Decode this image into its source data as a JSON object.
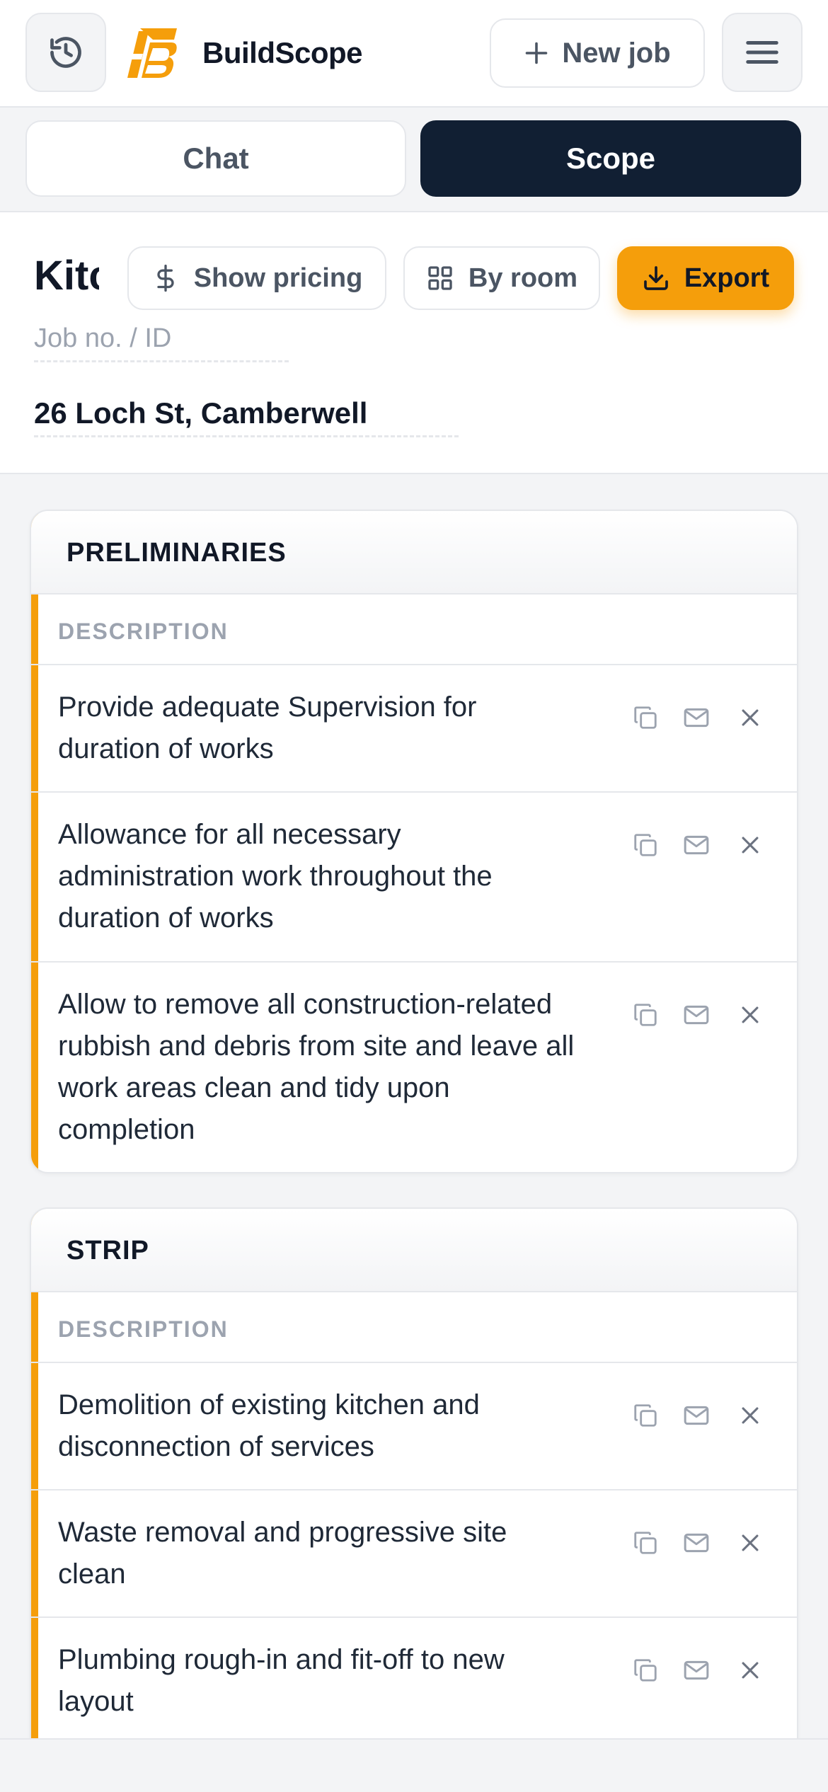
{
  "header": {
    "brand": "BuildScope",
    "new_job_label": "New job",
    "icons": {
      "history": "history-icon",
      "logo": "buildscope-logo",
      "plus": "plus-icon",
      "menu": "hamburger-menu-icon"
    }
  },
  "tabs": [
    {
      "label": "Chat",
      "active": false
    },
    {
      "label": "Scope",
      "active": true
    }
  ],
  "job": {
    "title": "Kitc",
    "number_placeholder": "Job no. / ID",
    "address": "26 Loch St, Camberwell",
    "actions": {
      "show_pricing": "Show pricing",
      "by_room": "By room",
      "export": "Export"
    }
  },
  "colors": {
    "accent": "#f59e0b",
    "navy": "#111f33",
    "border": "#e5e7eb",
    "muted": "#9ca3af"
  },
  "sections": [
    {
      "title": "PRELIMINARIES",
      "column": "DESCRIPTION",
      "items": [
        "Provide adequate Supervision for duration of works",
        "Allowance for all necessary administration work throughout the duration of works",
        "Allow to remove all construction-related rubbish and debris from site and leave all work areas clean and tidy upon completion"
      ]
    },
    {
      "title": "STRIP",
      "column": "DESCRIPTION",
      "items": [
        "Demolition of existing kitchen and disconnection of services",
        "Waste removal and progressive site clean",
        "Plumbing rough-in and fit-off to new layout"
      ]
    }
  ]
}
